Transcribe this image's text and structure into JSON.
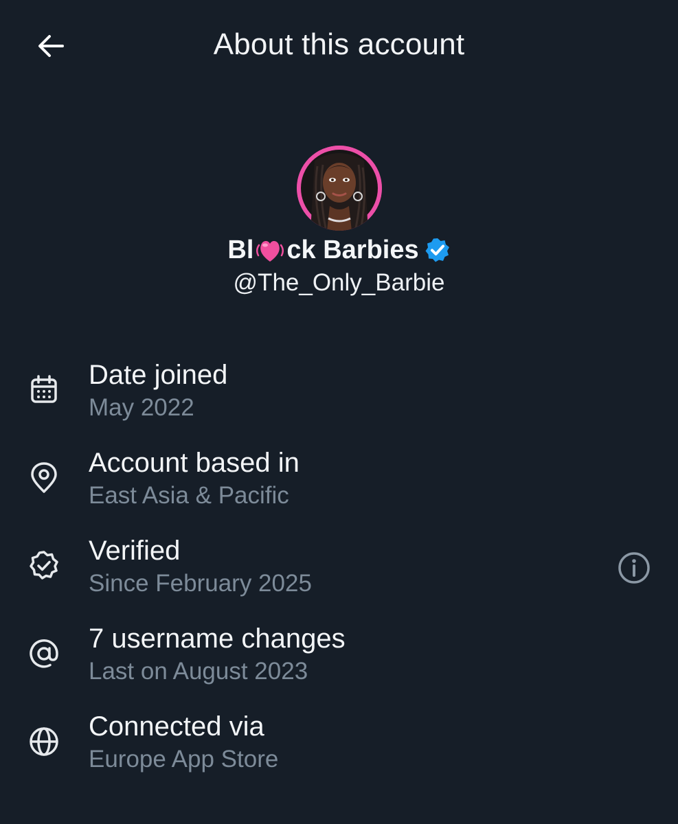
{
  "header": {
    "title": "About this account",
    "back_icon": "arrow-left-icon"
  },
  "profile": {
    "name_start": "Bl",
    "name_emoji": "heart-emoji",
    "name_end": "ck Barbies",
    "verified_badge": "verified-badge-icon",
    "handle": "@The_Only_Barbie"
  },
  "info": [
    {
      "icon": "calendar-icon",
      "label": "Date joined",
      "value": "May 2022"
    },
    {
      "icon": "location-pin-icon",
      "label": "Account based in",
      "value": "East Asia & Pacific"
    },
    {
      "icon": "verified-check-icon",
      "label": "Verified",
      "value": "Since February 2025",
      "action_icon": "info-icon"
    },
    {
      "icon": "at-sign-icon",
      "label": "7 username changes",
      "value": "Last on August 2023"
    },
    {
      "icon": "globe-icon",
      "label": "Connected via",
      "value": "Europe App Store"
    }
  ],
  "colors": {
    "background": "#161e28",
    "text_primary": "#f3f5f7",
    "text_secondary": "#7d8b99",
    "verified_blue": "#1d9bf0",
    "avatar_ring": "#ec4fa8",
    "heart_pink": "#f04f9e"
  }
}
